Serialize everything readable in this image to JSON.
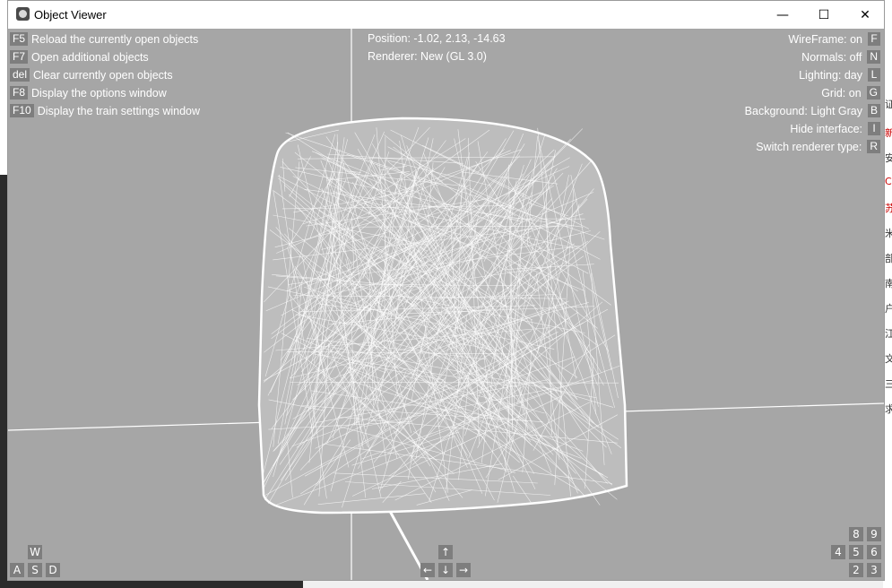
{
  "window": {
    "title": "Object Viewer",
    "minimize": "—",
    "maximize": "☐",
    "close": "✕"
  },
  "info": {
    "position": "Position: -1.02, 2.13, -14.63",
    "renderer": "Renderer: New (GL 3.0)"
  },
  "left_shortcuts": [
    {
      "key": "F5",
      "label": "Reload the currently open objects"
    },
    {
      "key": "F7",
      "label": "Open additional objects"
    },
    {
      "key": "del",
      "label": "Clear currently open objects"
    },
    {
      "key": "F8",
      "label": "Display the options window"
    },
    {
      "key": "F10",
      "label": "Display the train settings window"
    }
  ],
  "right_toggles": [
    {
      "label": "WireFrame: on",
      "key": "F"
    },
    {
      "label": "Normals: off",
      "key": "N"
    },
    {
      "label": "Lighting: day",
      "key": "L"
    },
    {
      "label": "Grid: on",
      "key": "G"
    },
    {
      "label": "Background: Light Gray",
      "key": "B"
    },
    {
      "label": "Hide interface:",
      "key": "I"
    },
    {
      "label": "Switch renderer type:",
      "key": "R"
    }
  ],
  "wasd": {
    "w": "W",
    "a": "A",
    "s": "S",
    "d": "D"
  },
  "arrows": {
    "up": "↑",
    "left": "←",
    "down": "↓",
    "right": "→"
  },
  "numpad": {
    "n8": "8",
    "n9": "9",
    "n4": "4",
    "n5": "5",
    "n6": "6",
    "n2": "2",
    "n3": "3"
  },
  "behind_window_chars": [
    "证",
    "新",
    "安",
    "C",
    "苏",
    "米",
    "部",
    "南",
    "户",
    "江",
    "文",
    "三",
    "求"
  ]
}
